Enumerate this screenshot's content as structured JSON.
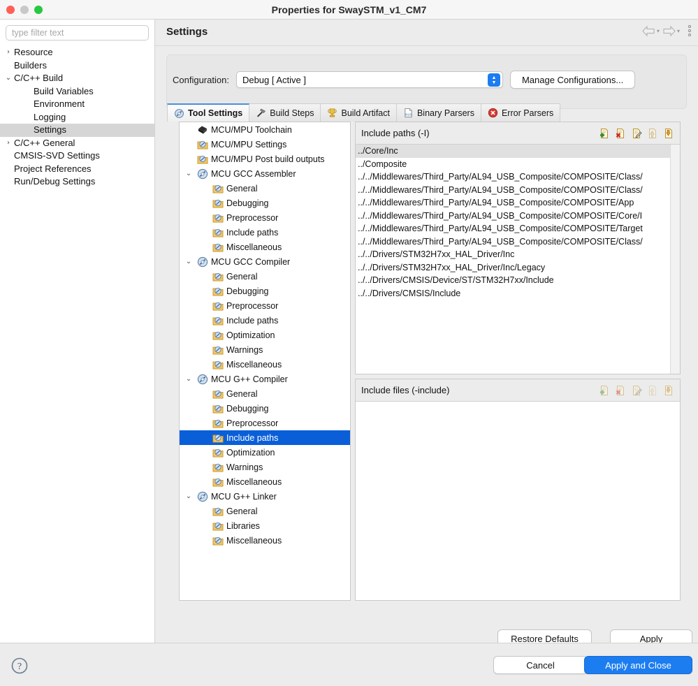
{
  "window": {
    "title": "Properties for SwaySTM_v1_CM7"
  },
  "sidebar": {
    "filter_placeholder": "type filter text",
    "items": [
      {
        "label": "Resource",
        "twisty": "›",
        "indent": 0,
        "selected": false
      },
      {
        "label": "Builders",
        "twisty": "",
        "indent": 0,
        "selected": false
      },
      {
        "label": "C/C++ Build",
        "twisty": "⌄",
        "indent": 0,
        "selected": false
      },
      {
        "label": "Build Variables",
        "twisty": "",
        "indent": 1,
        "selected": false
      },
      {
        "label": "Environment",
        "twisty": "",
        "indent": 1,
        "selected": false
      },
      {
        "label": "Logging",
        "twisty": "",
        "indent": 1,
        "selected": false
      },
      {
        "label": "Settings",
        "twisty": "",
        "indent": 1,
        "selected": true
      },
      {
        "label": "C/C++ General",
        "twisty": "›",
        "indent": 0,
        "selected": false
      },
      {
        "label": "CMSIS-SVD Settings",
        "twisty": "",
        "indent": 0,
        "selected": false
      },
      {
        "label": "Project References",
        "twisty": "",
        "indent": 0,
        "selected": false
      },
      {
        "label": "Run/Debug Settings",
        "twisty": "",
        "indent": 0,
        "selected": false
      }
    ]
  },
  "pane": {
    "title": "Settings",
    "config_label": "Configuration:",
    "config_value": "Debug  [ Active ]",
    "manage_label": "Manage Configurations..."
  },
  "tabs": [
    {
      "label": "Tool Settings",
      "icon": "gear-icon",
      "active": true
    },
    {
      "label": "Build Steps",
      "icon": "hammer-icon",
      "active": false
    },
    {
      "label": "Build Artifact",
      "icon": "trophy-icon",
      "active": false
    },
    {
      "label": "Binary Parsers",
      "icon": "binary-file-icon",
      "active": false
    },
    {
      "label": "Error Parsers",
      "icon": "error-circle-icon",
      "active": false
    }
  ],
  "tool_tree": [
    {
      "label": "MCU/MPU Toolchain",
      "level": 0,
      "twisty": "",
      "icon": "chip-icon",
      "selected": false
    },
    {
      "label": "MCU/MPU Settings",
      "level": 0,
      "twisty": "",
      "icon": "folder-icon",
      "selected": false
    },
    {
      "label": "MCU/MPU Post build outputs",
      "level": 0,
      "twisty": "",
      "icon": "folder-icon",
      "selected": false
    },
    {
      "label": "MCU GCC Assembler",
      "level": 0,
      "twisty": "⌄",
      "icon": "tool-icon",
      "selected": false
    },
    {
      "label": "General",
      "level": 1,
      "twisty": "",
      "icon": "folder-icon",
      "selected": false
    },
    {
      "label": "Debugging",
      "level": 1,
      "twisty": "",
      "icon": "folder-icon",
      "selected": false
    },
    {
      "label": "Preprocessor",
      "level": 1,
      "twisty": "",
      "icon": "folder-icon",
      "selected": false
    },
    {
      "label": "Include paths",
      "level": 1,
      "twisty": "",
      "icon": "folder-icon",
      "selected": false
    },
    {
      "label": "Miscellaneous",
      "level": 1,
      "twisty": "",
      "icon": "folder-icon",
      "selected": false
    },
    {
      "label": "MCU GCC Compiler",
      "level": 0,
      "twisty": "⌄",
      "icon": "tool-icon",
      "selected": false
    },
    {
      "label": "General",
      "level": 1,
      "twisty": "",
      "icon": "folder-icon",
      "selected": false
    },
    {
      "label": "Debugging",
      "level": 1,
      "twisty": "",
      "icon": "folder-icon",
      "selected": false
    },
    {
      "label": "Preprocessor",
      "level": 1,
      "twisty": "",
      "icon": "folder-icon",
      "selected": false
    },
    {
      "label": "Include paths",
      "level": 1,
      "twisty": "",
      "icon": "folder-icon",
      "selected": false
    },
    {
      "label": "Optimization",
      "level": 1,
      "twisty": "",
      "icon": "folder-icon",
      "selected": false
    },
    {
      "label": "Warnings",
      "level": 1,
      "twisty": "",
      "icon": "folder-icon",
      "selected": false
    },
    {
      "label": "Miscellaneous",
      "level": 1,
      "twisty": "",
      "icon": "folder-icon",
      "selected": false
    },
    {
      "label": "MCU G++ Compiler",
      "level": 0,
      "twisty": "⌄",
      "icon": "tool-icon",
      "selected": false
    },
    {
      "label": "General",
      "level": 1,
      "twisty": "",
      "icon": "folder-icon",
      "selected": false
    },
    {
      "label": "Debugging",
      "level": 1,
      "twisty": "",
      "icon": "folder-icon",
      "selected": false
    },
    {
      "label": "Preprocessor",
      "level": 1,
      "twisty": "",
      "icon": "folder-icon",
      "selected": false
    },
    {
      "label": "Include paths",
      "level": 1,
      "twisty": "",
      "icon": "folder-icon",
      "selected": true
    },
    {
      "label": "Optimization",
      "level": 1,
      "twisty": "",
      "icon": "folder-icon",
      "selected": false
    },
    {
      "label": "Warnings",
      "level": 1,
      "twisty": "",
      "icon": "folder-icon",
      "selected": false
    },
    {
      "label": "Miscellaneous",
      "level": 1,
      "twisty": "",
      "icon": "folder-icon",
      "selected": false
    },
    {
      "label": "MCU G++ Linker",
      "level": 0,
      "twisty": "⌄",
      "icon": "tool-icon",
      "selected": false
    },
    {
      "label": "General",
      "level": 1,
      "twisty": "",
      "icon": "folder-icon",
      "selected": false
    },
    {
      "label": "Libraries",
      "level": 1,
      "twisty": "",
      "icon": "folder-icon",
      "selected": false
    },
    {
      "label": "Miscellaneous",
      "level": 1,
      "twisty": "",
      "icon": "folder-icon",
      "selected": false
    }
  ],
  "include_paths": {
    "title": "Include paths (-I)",
    "toolbar": [
      "add-icon",
      "delete-icon",
      "edit-icon",
      "move-up-icon",
      "move-down-icon"
    ],
    "rows": [
      {
        "value": "../Core/Inc",
        "selected": true
      },
      {
        "value": "../Composite",
        "selected": false
      },
      {
        "value": "../../Middlewares/Third_Party/AL94_USB_Composite/COMPOSITE/Class/",
        "selected": false
      },
      {
        "value": "../../Middlewares/Third_Party/AL94_USB_Composite/COMPOSITE/Class/",
        "selected": false
      },
      {
        "value": "../../Middlewares/Third_Party/AL94_USB_Composite/COMPOSITE/App",
        "selected": false
      },
      {
        "value": "../../Middlewares/Third_Party/AL94_USB_Composite/COMPOSITE/Core/I",
        "selected": false
      },
      {
        "value": "../../Middlewares/Third_Party/AL94_USB_Composite/COMPOSITE/Target",
        "selected": false
      },
      {
        "value": "../../Middlewares/Third_Party/AL94_USB_Composite/COMPOSITE/Class/",
        "selected": false
      },
      {
        "value": "../../Drivers/STM32H7xx_HAL_Driver/Inc",
        "selected": false
      },
      {
        "value": "../../Drivers/STM32H7xx_HAL_Driver/Inc/Legacy",
        "selected": false
      },
      {
        "value": "../../Drivers/CMSIS/Device/ST/STM32H7xx/Include",
        "selected": false
      },
      {
        "value": "../../Drivers/CMSIS/Include",
        "selected": false
      }
    ]
  },
  "include_files": {
    "title": "Include files (-include)",
    "toolbar": [
      "add-icon",
      "delete-icon",
      "edit-icon",
      "move-up-icon",
      "move-down-icon"
    ],
    "rows": []
  },
  "buttons": {
    "restore_defaults": "Restore Defaults",
    "apply": "Apply",
    "cancel": "Cancel",
    "apply_and_close": "Apply and Close"
  },
  "colors": {
    "accent_blue": "#1c7df0",
    "tree_selection": "#0a5fd8",
    "window_bg": "#ececec"
  }
}
